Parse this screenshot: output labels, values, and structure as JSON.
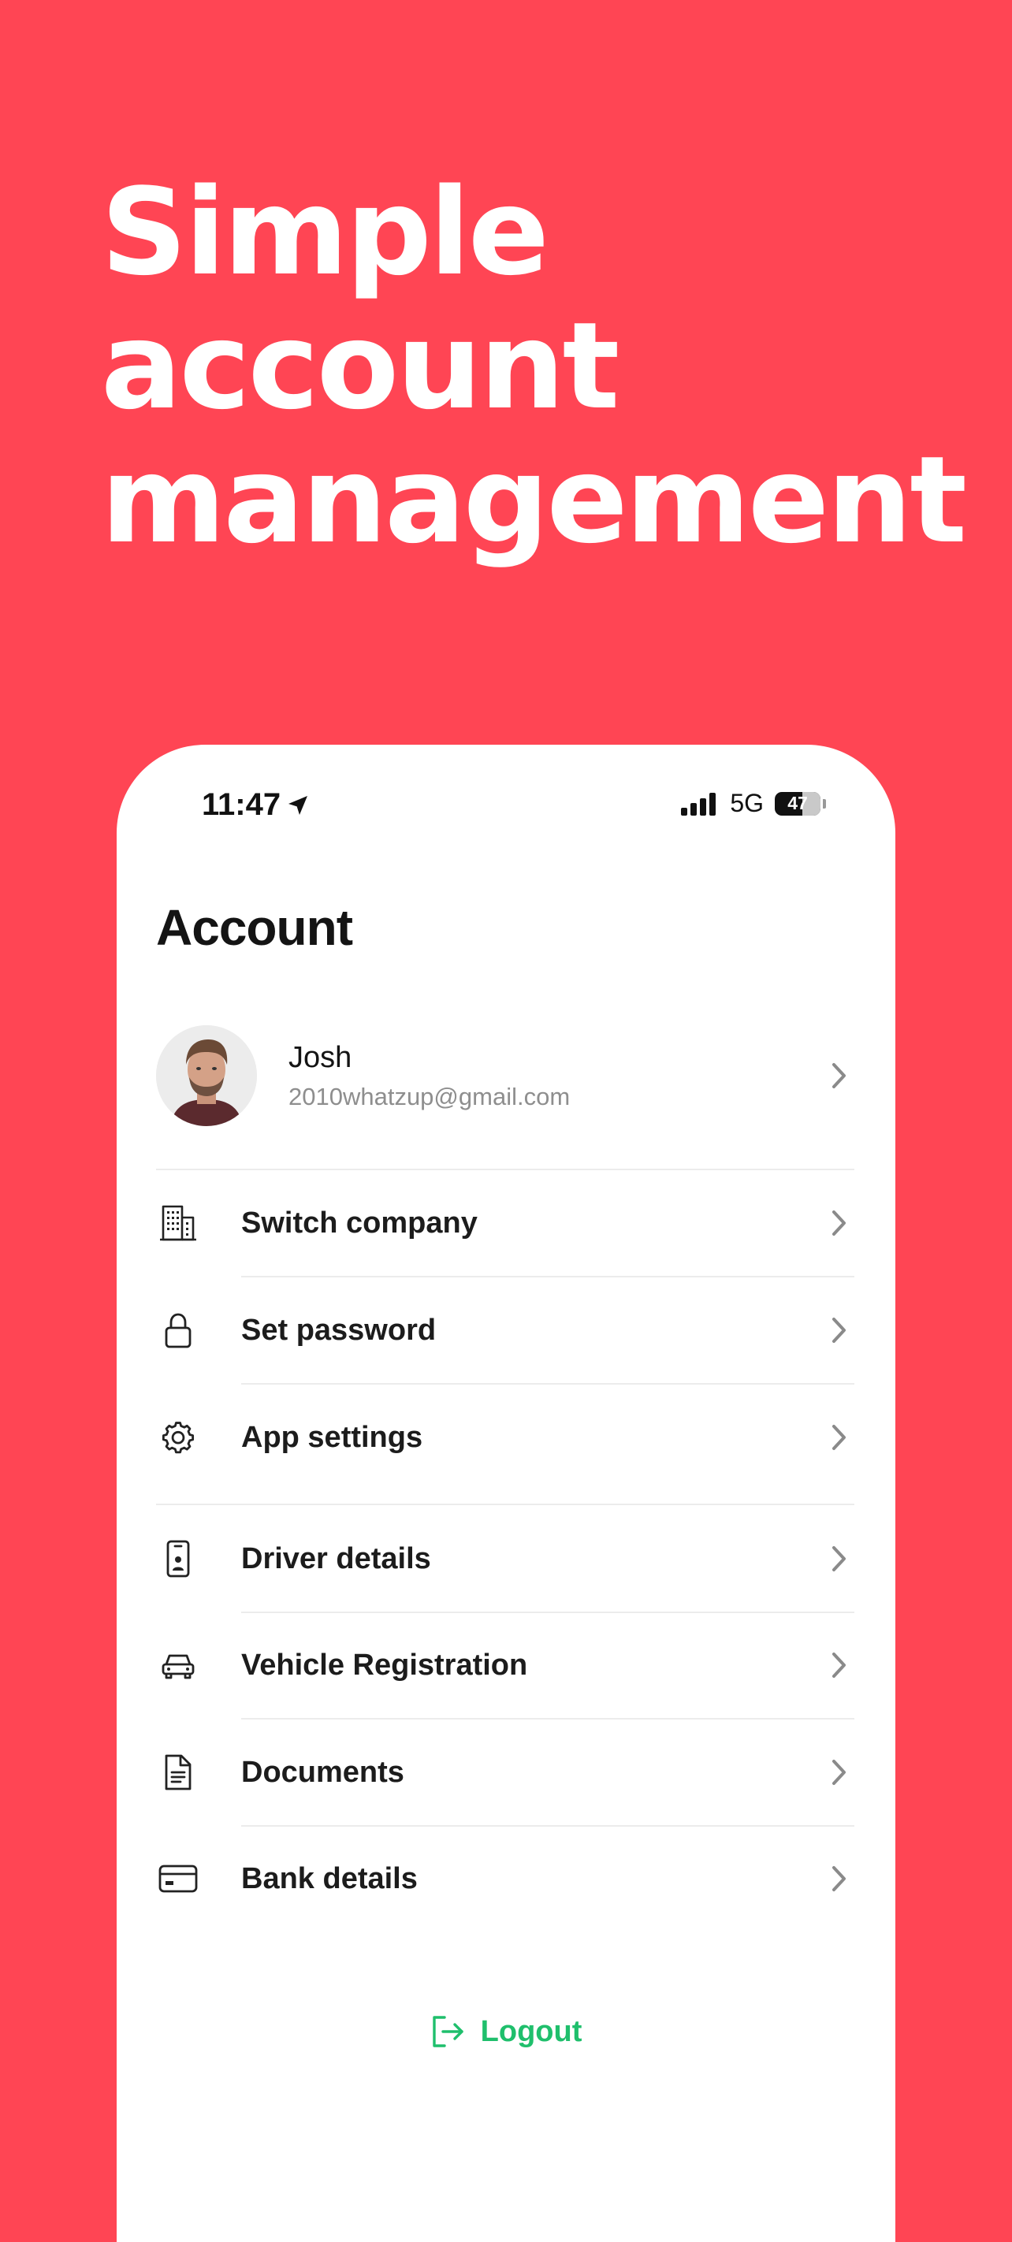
{
  "headline": {
    "line1": "Simple",
    "line2": "account",
    "line3": "management"
  },
  "status_bar": {
    "time": "11:47",
    "network": "5G",
    "battery": "47"
  },
  "account": {
    "title": "Account",
    "profile": {
      "name": "Josh",
      "email": "2010whatzup@gmail.com"
    },
    "items": [
      {
        "label": "Switch company",
        "icon": "building-icon"
      },
      {
        "label": "Set password",
        "icon": "lock-icon"
      },
      {
        "label": "App settings",
        "icon": "gear-icon"
      },
      {
        "label": "Driver details",
        "icon": "id-badge-icon"
      },
      {
        "label": "Vehicle Registration",
        "icon": "car-icon"
      },
      {
        "label": "Documents",
        "icon": "document-icon"
      },
      {
        "label": "Bank details",
        "icon": "credit-card-icon"
      }
    ],
    "logout_label": "Logout"
  },
  "colors": {
    "background": "#FF4554",
    "accent_green": "#1FBF6C"
  }
}
